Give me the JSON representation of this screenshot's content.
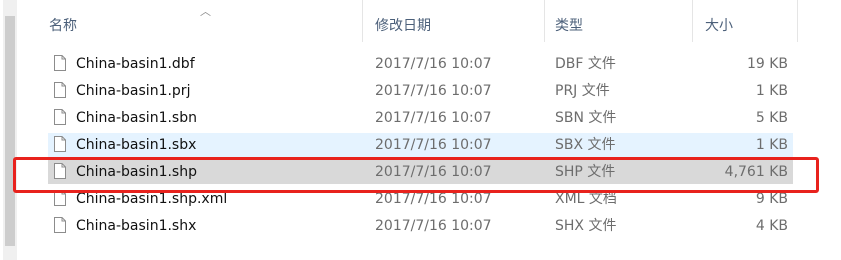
{
  "columns": {
    "name": "名称",
    "date": "修改日期",
    "type": "类型",
    "size": "大小"
  },
  "files": [
    {
      "name": "China-basin1.dbf",
      "date": "2017/7/16 10:07",
      "type": "DBF 文件",
      "size": "19 KB"
    },
    {
      "name": "China-basin1.prj",
      "date": "2017/7/16 10:07",
      "type": "PRJ 文件",
      "size": "1 KB"
    },
    {
      "name": "China-basin1.sbn",
      "date": "2017/7/16 10:07",
      "type": "SBN 文件",
      "size": "5 KB"
    },
    {
      "name": "China-basin1.sbx",
      "date": "2017/7/16 10:07",
      "type": "SBX 文件",
      "size": "1 KB"
    },
    {
      "name": "China-basin1.shp",
      "date": "2017/7/16 10:07",
      "type": "SHP 文件",
      "size": "4,761 KB"
    },
    {
      "name": "China-basin1.shp.xml",
      "date": "2017/7/16 10:07",
      "type": "XML 文档",
      "size": "9 KB"
    },
    {
      "name": "China-basin1.shx",
      "date": "2017/7/16 10:07",
      "type": "SHX 文件",
      "size": "4 KB"
    }
  ],
  "colors": {
    "hover_row": "#e5f3ff",
    "selected_row": "#d9d9d9",
    "annotation_box": "#e8221d",
    "header_text": "#4c607a"
  },
  "icons": {
    "file": "file-icon",
    "sort": "sort-up-icon"
  }
}
